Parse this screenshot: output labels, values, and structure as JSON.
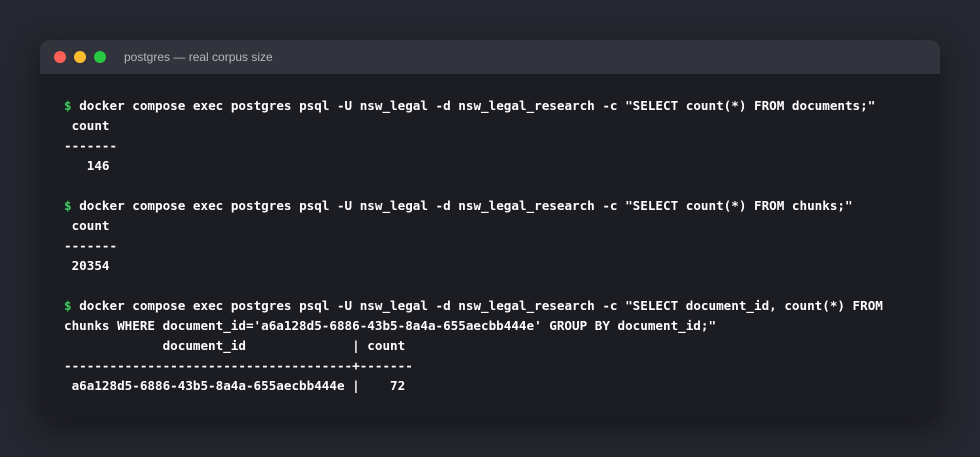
{
  "window": {
    "title": "postgres — real corpus size"
  },
  "blocks": [
    {
      "prompt": "$",
      "command": "docker compose exec postgres psql -U nsw_legal -d nsw_legal_research -c \"SELECT count(*) FROM documents;\"",
      "output": [
        " count",
        "-------",
        "   146"
      ]
    },
    {
      "prompt": "$",
      "command": "docker compose exec postgres psql -U nsw_legal -d nsw_legal_research -c \"SELECT count(*) FROM chunks;\"",
      "output": [
        " count",
        "-------",
        " 20354"
      ]
    },
    {
      "prompt": "$",
      "command": "docker compose exec postgres psql -U nsw_legal -d nsw_legal_research -c \"SELECT document_id, count(*) FROM",
      "command_cont": "chunks WHERE document_id='a6a128d5-6886-43b5-8a4a-655aecbb444e' GROUP BY document_id;\"",
      "output": [
        "             document_id              | count",
        "--------------------------------------+-------",
        " a6a128d5-6886-43b5-8a4a-655aecbb444e |    72"
      ]
    }
  ],
  "colors": {
    "prompt": "#3fcf5e",
    "background": "#1c1c23",
    "titlebar": "#33333d"
  }
}
